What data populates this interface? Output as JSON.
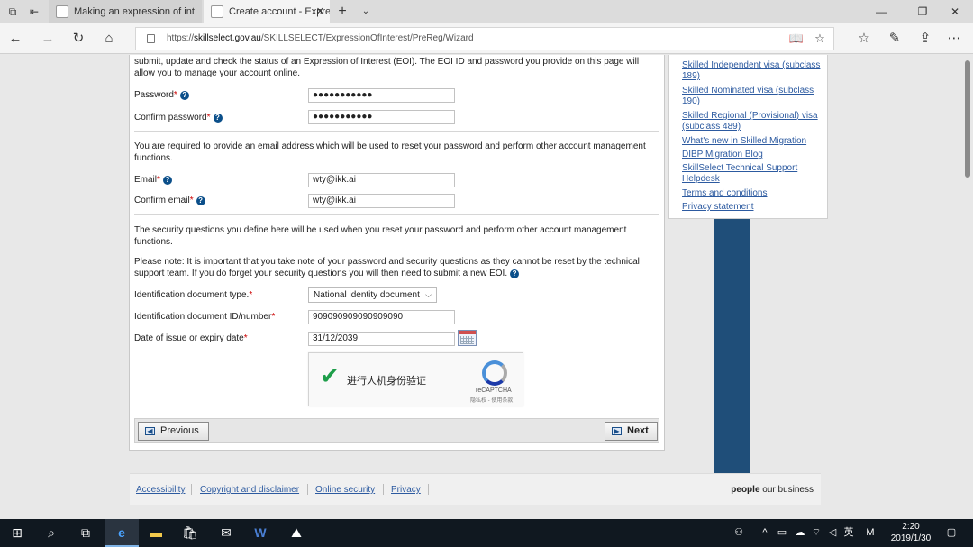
{
  "browser": {
    "tabs": [
      {
        "title": "Making an expression of int",
        "active": false
      },
      {
        "title": "Create account - Expres",
        "active": true
      }
    ],
    "url_prefix": "https://",
    "url_host": "skillselect.gov.au",
    "url_path": "/SKILLSELECT/ExpressionOfInterest/PreReg/Wizard"
  },
  "form": {
    "intro": "submit, update and check the status of an Expression of Interest (EOI). The EOI ID and password you provide on this page will allow you to manage your account online.",
    "password_label": "Password",
    "password_value": "●●●●●●●●●●●",
    "confirm_password_label": "Confirm password",
    "confirm_password_value": "●●●●●●●●●●●",
    "email_note": "You are required to provide an email address which will be used to reset your password and perform other account management functions.",
    "email_label": "Email",
    "email_value": "wty@ikk.ai",
    "confirm_email_label": "Confirm email",
    "confirm_email_value": "wty@ikk.ai",
    "security_note": "The security questions you define here will be used when you reset your password and perform other account management functions.",
    "warning_note": "Please note: It is important that you take note of your password and security questions as they cannot be reset by the technical support team. If you do forget your security questions you will then need to submit a new EOI.",
    "id_doc_type_label": "Identification document type.",
    "id_doc_type_value": "National identity document",
    "id_doc_number_label": "Identification document ID/number",
    "id_doc_number_value": "909090909090909090",
    "date_label": "Date of issue or expiry date",
    "date_value": "31/12/2039",
    "required_mark": "*",
    "captcha_label": "进行人机身份验证",
    "captcha_brand": "reCAPTCHA",
    "captcha_terms": "隐私权 - 使用条款",
    "previous_label": "Previous",
    "next_label": "Next"
  },
  "sidebar": {
    "links": [
      "Skilled Independent visa (subclass 189)",
      "Skilled Nominated visa (subclass 190)",
      "Skilled Regional (Provisional) visa (subclass 489)",
      "What's new in Skilled Migration",
      "DIBP Migration Blog",
      "SkillSelect Technical Support Helpdesk",
      "Terms and conditions",
      "Privacy statement"
    ]
  },
  "footer": {
    "links": [
      "Accessibility",
      "Copyright and disclaimer",
      "Online security",
      "Privacy"
    ],
    "slogan_bold": "people",
    "slogan_rest": " our business"
  },
  "taskbar": {
    "ime_lang": "英",
    "ime_mode": "M",
    "time": "2:20",
    "date": "2019/1/30"
  }
}
